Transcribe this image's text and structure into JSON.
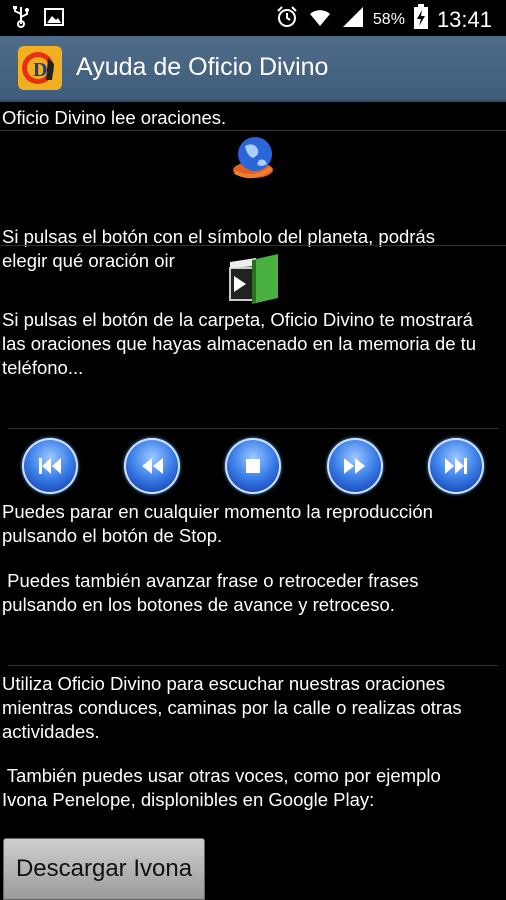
{
  "status_bar": {
    "battery_percent": "58%",
    "time": "13:41"
  },
  "app": {
    "title": "Ayuda de Oficio Divino"
  },
  "help": {
    "intro": "Oficio Divino lee oraciones.",
    "planet_text_1": "Si pulsas el botón con el símbolo del planeta, podrás",
    "planet_text_2": "elegir qué oración oir",
    "folder_text_1": "Si pulsas el botón de la carpeta, Oficio Divino te mostrará",
    "folder_text_2": "las oraciones que hayas almacenado en la memoria de tu",
    "folder_text_3": "teléfono...",
    "stop_text_1": "Puedes parar en cualquier momento la reproducción",
    "stop_text_2": "pulsando el botón de Stop.",
    "advance_text_1": " Puedes también avanzar frase o retroceder frases",
    "advance_text_2": "pulsando en los botones de avance y retroceso.",
    "use_text_1": "Utiliza Oficio Divino para escuchar nuestras oraciones",
    "use_text_2": "mientras conduces, caminas por la calle o realizas otras",
    "use_text_3": "actividades.",
    "voices_text_1": " También puedes usar otras voces, como por ejemplo",
    "voices_text_2": "Ivona Penelope, displonibles en Google Play:"
  },
  "controls": {
    "icons": [
      "skip-back-icon",
      "rewind-icon",
      "stop-icon",
      "fast-forward-icon",
      "skip-forward-icon"
    ]
  },
  "download_button": {
    "label": "Descargar Ivona"
  }
}
